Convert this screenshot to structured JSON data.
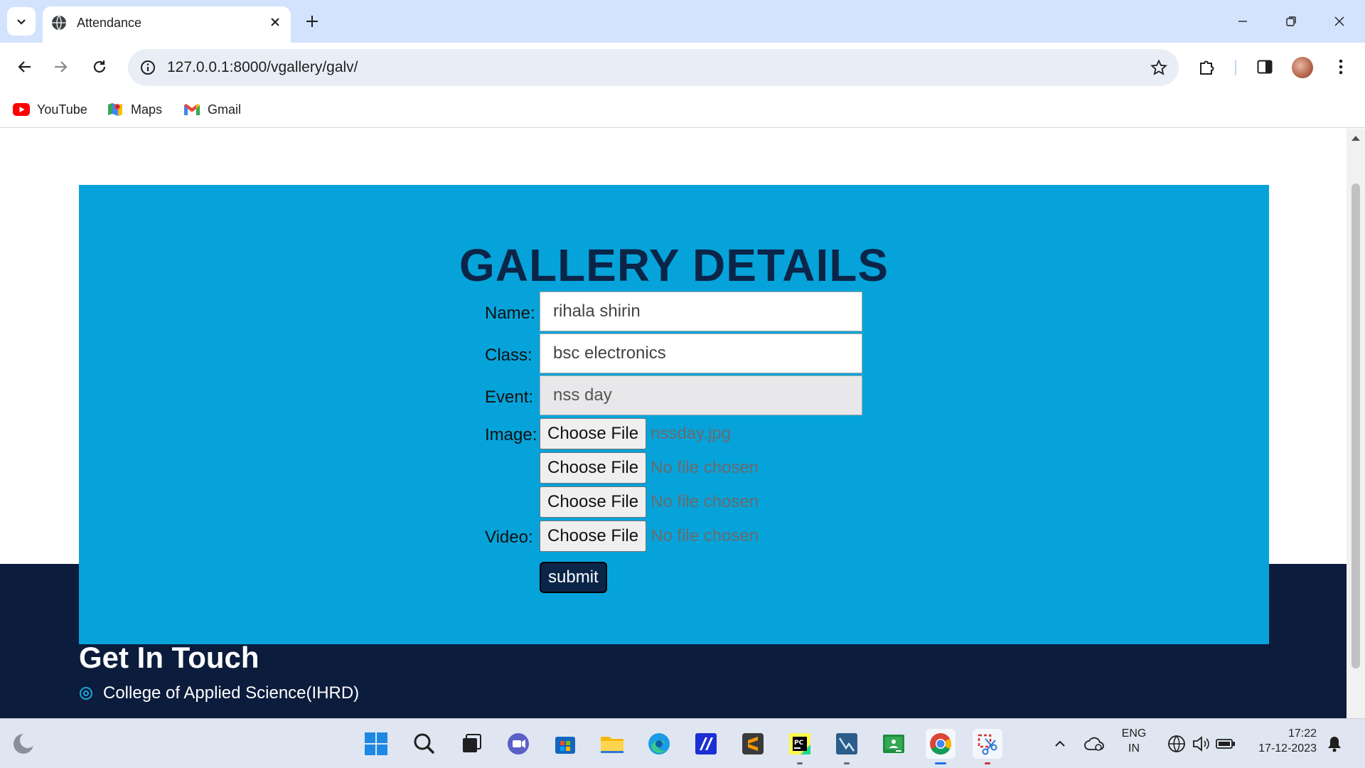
{
  "browser": {
    "tab_title": "Attendance",
    "url": "127.0.0.1:8000/vgallery/galv/",
    "bookmarks": [
      {
        "label": "YouTube",
        "icon": "youtube-icon"
      },
      {
        "label": "Maps",
        "icon": "maps-icon"
      },
      {
        "label": "Gmail",
        "icon": "gmail-icon"
      }
    ]
  },
  "page": {
    "title": "GALLERY DETAILS",
    "form": {
      "name_label": "Name:",
      "name_value": "rihala shirin",
      "class_label": "Class:",
      "class_value": "bsc electronics",
      "event_label": "Event:",
      "event_value": "nss day",
      "image_label": "Image:",
      "video_label": "Video:",
      "choose_file_label": "Choose File",
      "image_files": [
        "nssday.jpg",
        "No file chosen",
        "No file chosen"
      ],
      "video_file": "No file chosen",
      "submit_label": "submit"
    },
    "footer": {
      "title": "Get In Touch",
      "address": "College of Applied Science(IHRD)"
    }
  },
  "taskbar": {
    "lang_top": "ENG",
    "lang_bottom": "IN",
    "time": "17:22",
    "date": "17-12-2023"
  },
  "colors": {
    "gallery_bg": "#06a3da",
    "title_color": "#0b2548",
    "footer_bg": "#0b1c3c",
    "submit_bg": "#0b2548"
  }
}
